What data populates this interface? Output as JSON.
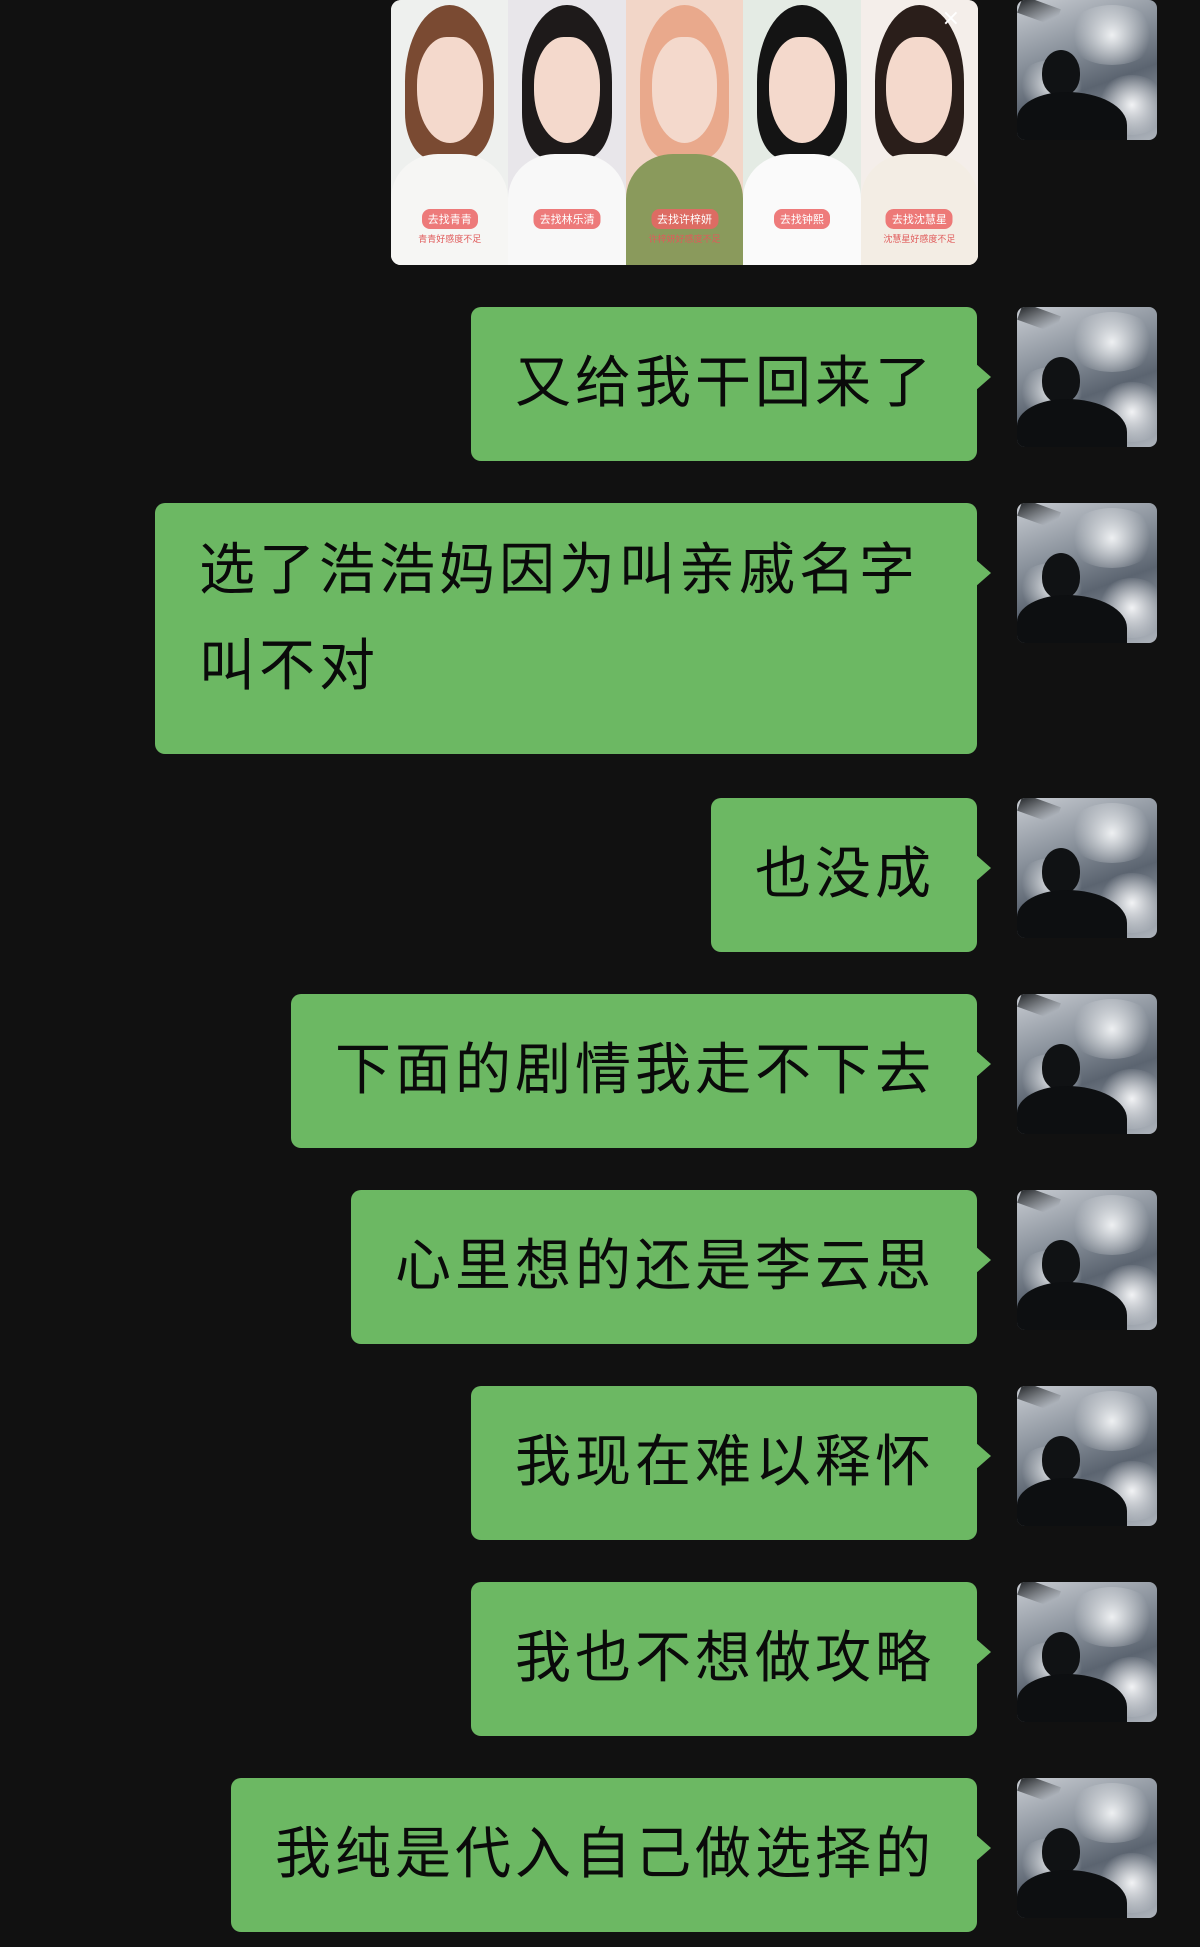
{
  "chat": {
    "image_message": {
      "close_icon": "×",
      "cards": [
        {
          "tag": "去找青青",
          "subtag": "青青好感度不足"
        },
        {
          "tag": "去找林乐清",
          "subtag": ""
        },
        {
          "tag": "去找许梓妍",
          "subtag": "许梓妍好感度不足"
        },
        {
          "tag": "去找钟熙",
          "subtag": ""
        },
        {
          "tag": "去找沈慧星",
          "subtag": "沈慧星好感度不足"
        }
      ]
    },
    "messages": [
      "又给我干回来了",
      "选了浩浩妈因为叫亲戚名字叫不对",
      "也没成",
      "下面的剧情我走不下去",
      "心里想的还是李云思",
      "我现在难以释怀",
      "我也不想做攻略",
      "我纯是代入自己做选择的"
    ],
    "bubble_color": "#6cb863",
    "background_color": "#111111"
  }
}
